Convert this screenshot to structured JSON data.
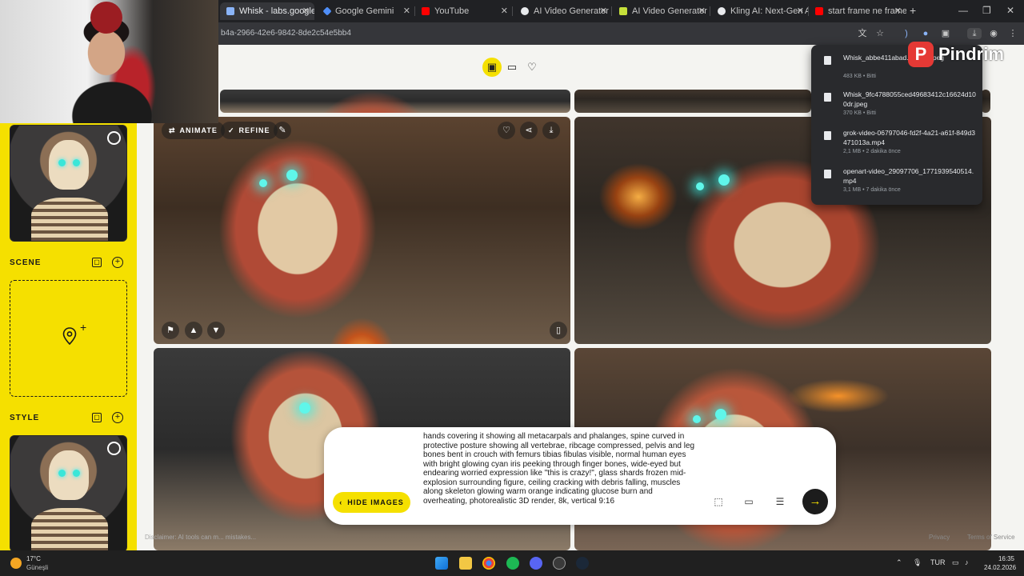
{
  "tabs": [
    {
      "label": "Whisk - labs.google/fx",
      "color": "#8ab4f8",
      "active": true
    },
    {
      "label": "Google Gemini",
      "color": "#4f8ef7"
    },
    {
      "label": "YouTube",
      "color": "#ff0000"
    },
    {
      "label": "AI Video Generator",
      "color": "#e8eaed"
    },
    {
      "label": "AI Video Generator &",
      "color": "#c6e03a"
    },
    {
      "label": "Kling AI: Next-Gen AI",
      "color": "#e8eaed"
    },
    {
      "label": "start frame ne frame",
      "color": "#ff0000"
    }
  ],
  "address": {
    "url": "b4a-2966-42e6-9842-8de2c54e5bb4"
  },
  "sidebar": {
    "scene_label": "SCENE",
    "style_label": "STYLE"
  },
  "image_card": {
    "animate_label": "ANIMATE",
    "refine_label": "REFINE"
  },
  "prompt": {
    "hide_images_label": "HIDE IMAGES",
    "text": "hands covering it showing all metacarpals and phalanges, spine curved in protective posture showing all vertebrae, ribcage compressed, pelvis and leg bones bent in crouch with femurs tibias fibulas visible, normal human eyes with bright glowing cyan iris peeking through finger bones, wide-eyed but endearing worried expression like \"this is crazy!\", glass shards frozen mid-explosion surrounding figure, ceiling cracking with debris falling, muscles along skeleton glowing warm orange indicating glucose burn and overheating, photorealistic 3D render, 8k, vertical 9:16"
  },
  "downloads": [
    {
      "name": "Whisk_abbe411abad...3addr.jpeg",
      "meta": "483 KB • Bitti"
    },
    {
      "name": "Whisk_9fc4788055ced49683412c16624d100dr.jpeg",
      "meta": "370 KB • Bitti"
    },
    {
      "name": "grok-video-06797046-fd2f-4a21-a61f-849d3471013a.mp4",
      "meta": "2,1 MB • 2 dakika önce"
    },
    {
      "name": "openart-video_29097706_1771939540514.mp4",
      "meta": "3,1 MB • 7 dakika önce"
    }
  ],
  "footer": {
    "disclaimer": "Disclaimer: AI tools can m... mistakes...",
    "privacy": "Privacy",
    "terms": "Terms of Service"
  },
  "overlay": {
    "brand_letter": "P",
    "brand_text": "Pindrim"
  },
  "taskbar": {
    "temperature": "17°C",
    "weather": "Güneşli",
    "language": "TUR",
    "time": "16:35",
    "date": "24.02.2026"
  },
  "colors": {
    "accent": "#f5e000",
    "dark": "#1c1c1c"
  }
}
